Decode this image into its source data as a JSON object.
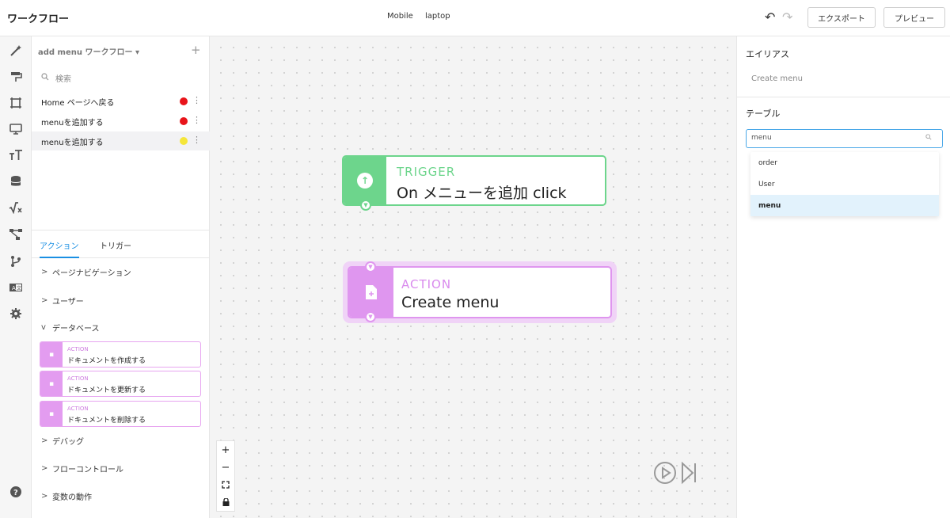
{
  "topbar": {
    "title": "ワークフロー",
    "device_tabs": [
      "Mobile",
      "laptop"
    ],
    "export_label": "エクスポート",
    "preview_label": "プレビュー"
  },
  "rail": {
    "icons": [
      "magic-wand-icon",
      "paint-roller-icon",
      "frame-icon",
      "monitor-icon",
      "text-size-icon",
      "database-icon",
      "formula-icon",
      "workflow-icon",
      "branch-icon",
      "translate-icon",
      "gear-icon",
      "help-icon"
    ]
  },
  "workflows": {
    "selector": "add menu ワークフロー",
    "search_placeholder": "検索",
    "items": [
      {
        "label": "Home ページへ戻る",
        "dot_color": "#e8141a"
      },
      {
        "label": "menuを追加する",
        "dot_color": "#e8141a"
      },
      {
        "label": "menuを追加する",
        "dot_color": "#f5e63a"
      }
    ]
  },
  "tabs": {
    "actions": "アクション",
    "triggers": "トリガー"
  },
  "categories": {
    "page_nav": "ページナビゲーション",
    "user": "ユーザー",
    "database": "データベース",
    "debug": "デバッグ",
    "flow_control": "フローコントロール",
    "variables": "変数の動作"
  },
  "db_actions": [
    {
      "kind": "ACTION",
      "name": "ドキュメントを作成する"
    },
    {
      "kind": "ACTION",
      "name": "ドキュメントを更新する"
    },
    {
      "kind": "ACTION",
      "name": "ドキュメントを削除する"
    }
  ],
  "canvas": {
    "trigger": {
      "kind": "TRIGGER",
      "name": "On メニューを追加 click"
    },
    "action": {
      "kind": "ACTION",
      "name": "Create menu"
    }
  },
  "inspector": {
    "alias_title": "エイリアス",
    "alias_value": "Create menu",
    "table_title": "テーブル",
    "table_search_value": "menu",
    "options": [
      "order",
      "User",
      "menu"
    ],
    "selected_option": "menu"
  },
  "colors": {
    "trigger": "#6dd58c",
    "action": "#df96ef",
    "accent": "#1a8fe3"
  }
}
